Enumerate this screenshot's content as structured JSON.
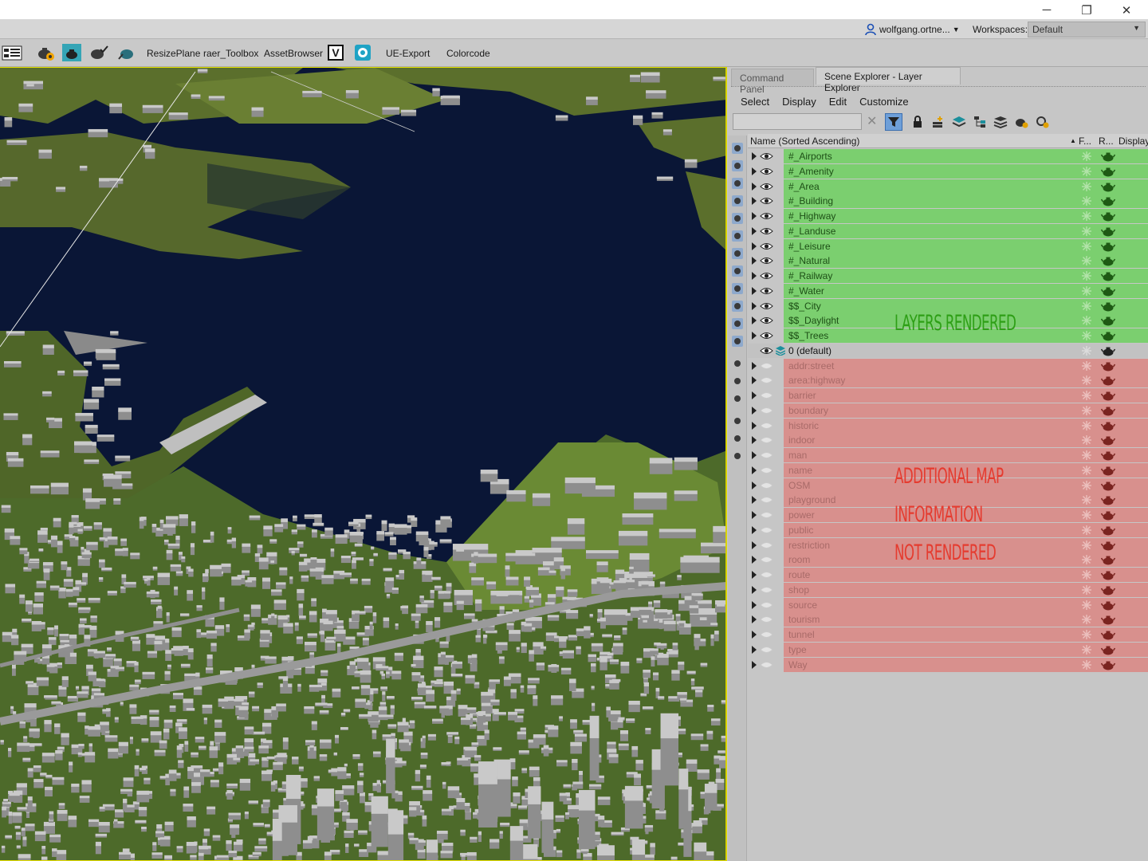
{
  "window": {
    "minimize_label": "─",
    "restore_label": "❐",
    "close_label": "✕"
  },
  "account": {
    "user": "wolfgang.ortne...",
    "workspaces_label": "Workspaces:",
    "workspace_value": "Default"
  },
  "toolbar": {
    "items": [
      "ResizePlane",
      "raer_Toolbox",
      "AssetBrowser",
      "UE-Export",
      "Colorcode"
    ],
    "v_label": "V"
  },
  "panel": {
    "tabs": [
      "Command Panel",
      "Scene Explorer - Layer Explorer"
    ],
    "menu": [
      "Select",
      "Display",
      "Edit",
      "Customize"
    ],
    "search_clear": "✕",
    "columns": {
      "name": "Name (Sorted Ascending)",
      "sort_arrow": "▲",
      "f": "F...",
      "r": "R...",
      "display": "Display"
    }
  },
  "layers": {
    "rendered": [
      "#_Airports",
      "#_Amenity",
      "#_Area",
      "#_Building",
      "#_Highway",
      "#_Landuse",
      "#_Leisure",
      "#_Natural",
      "#_Railway",
      "#_Water",
      "$$_City",
      "$$_Daylight",
      "$$_Trees"
    ],
    "default": "0 (default)",
    "not_rendered": [
      "addr:street",
      "area:highway",
      "barrier",
      "boundary",
      "historic",
      "indoor",
      "man",
      "name",
      "OSM",
      "playground",
      "power",
      "public",
      "restriction",
      "room",
      "route",
      "shop",
      "source",
      "tourism",
      "tunnel",
      "type",
      "Way"
    ]
  },
  "annotations": {
    "rendered": "LAYERS RENDERED",
    "not_rendered_line1": "ADDITIONAL MAP",
    "not_rendered_line2": "INFORMATION",
    "not_rendered_line3": "NOT RENDERED"
  },
  "colors": {
    "rendered_row": "#7bcf6f",
    "not_rendered_row": "#d8908d",
    "annotation_green": "#2e9f16",
    "annotation_red": "#e53b2f",
    "viewport_border": "#e5e000"
  }
}
